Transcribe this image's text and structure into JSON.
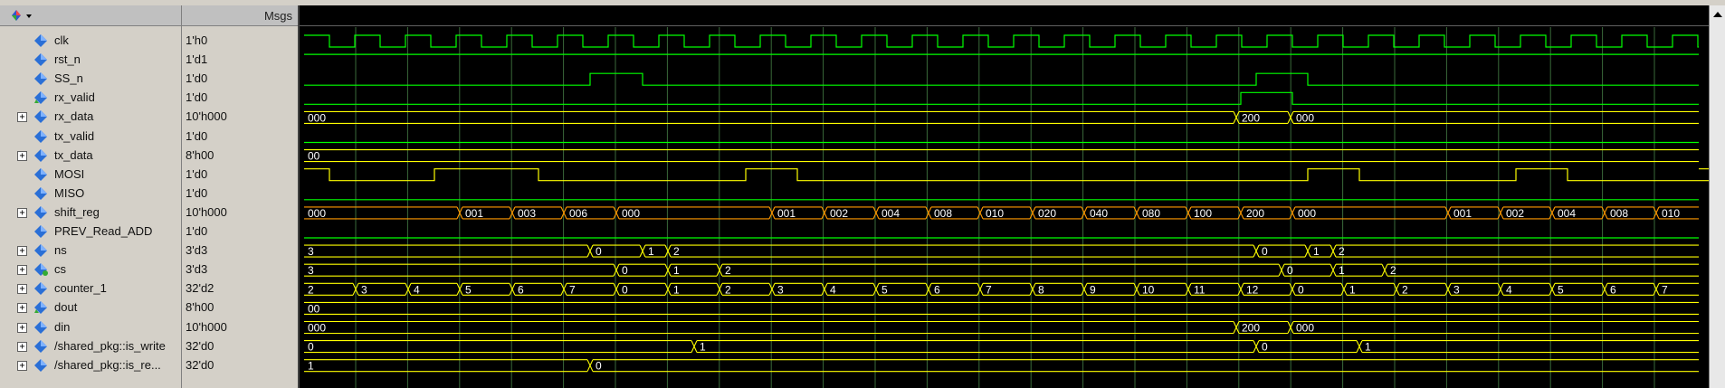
{
  "header": {
    "msgs_label": "Msgs"
  },
  "signals": [
    {
      "name": "clk",
      "value": "1'h0",
      "expandable": false,
      "icon": "signal-icon",
      "color": "#00ff00"
    },
    {
      "name": "rst_n",
      "value": "1'd1",
      "expandable": false,
      "icon": "signal-icon",
      "color": "#00ff00"
    },
    {
      "name": "SS_n",
      "value": "1'd0",
      "expandable": false,
      "icon": "signal-icon",
      "color": "#00ff00"
    },
    {
      "name": "rx_valid",
      "value": "1'd0",
      "expandable": false,
      "icon": "output-signal-icon",
      "color": "#00ff00"
    },
    {
      "name": "rx_data",
      "value": "10'h000",
      "expandable": true,
      "icon": "bus-signal-icon",
      "color": "#ffff00"
    },
    {
      "name": "tx_valid",
      "value": "1'd0",
      "expandable": false,
      "icon": "signal-icon",
      "color": "#00ff00"
    },
    {
      "name": "tx_data",
      "value": "8'h00",
      "expandable": true,
      "icon": "bus-signal-icon",
      "color": "#ffff00"
    },
    {
      "name": "MOSI",
      "value": "1'd0",
      "expandable": false,
      "icon": "signal-icon",
      "color": "#ffff00"
    },
    {
      "name": "MISO",
      "value": "1'd0",
      "expandable": false,
      "icon": "signal-icon",
      "color": "#00ff00"
    },
    {
      "name": "shift_reg",
      "value": "10'h000",
      "expandable": true,
      "icon": "bus-signal-icon",
      "color": "#ff9900"
    },
    {
      "name": "PREV_Read_ADD",
      "value": "1'd0",
      "expandable": false,
      "icon": "signal-icon",
      "color": "#00ff00"
    },
    {
      "name": "ns",
      "value": "3'd3",
      "expandable": true,
      "icon": "bus-signal-icon",
      "color": "#ffff00"
    },
    {
      "name": "cs",
      "value": "3'd3",
      "expandable": true,
      "icon": "state-signal-icon",
      "color": "#ffff00"
    },
    {
      "name": "counter_1",
      "value": "32'd2",
      "expandable": true,
      "icon": "bus-signal-icon",
      "color": "#ffff00"
    },
    {
      "name": "dout",
      "value": "8'h00",
      "expandable": true,
      "icon": "output-signal-icon",
      "color": "#ffff00"
    },
    {
      "name": "din",
      "value": "10'h000",
      "expandable": true,
      "icon": "bus-signal-icon",
      "color": "#ffff00"
    },
    {
      "name": "/shared_pkg::is_write",
      "value": "32'd0",
      "expandable": true,
      "icon": "bus-signal-icon",
      "color": "#ffff00"
    },
    {
      "name": "/shared_pkg::is_re...",
      "value": "32'd0",
      "expandable": true,
      "icon": "bus-signal-icon",
      "color": "#ffff00"
    }
  ],
  "waves": {
    "clk": {
      "type": "clock",
      "start": 0,
      "half_period": 28,
      "start_level": 1
    },
    "rst_n": {
      "type": "bit",
      "level0": 1,
      "edges": []
    },
    "SS_n": {
      "type": "bit",
      "level0": 0,
      "edges": [
        316,
        374,
        1052,
        1109
      ]
    },
    "rx_valid": {
      "type": "bit",
      "level0": 0,
      "edges": [
        1035,
        1092
      ],
      "mid_edge": true
    },
    "MOSI": {
      "type": "bit",
      "level0": 1,
      "edges": [
        28,
        144,
        259,
        488,
        545,
        1109,
        1166,
        1339,
        1396,
        1569
      ]
    },
    "tx_valid": {
      "type": "bit",
      "level0": 0,
      "edges": []
    },
    "MISO": {
      "type": "bit",
      "level0": 0,
      "edges": []
    },
    "PREV_Read_ADD": {
      "type": "bit",
      "level0": 0,
      "edges": []
    },
    "rx_data": {
      "type": "bus",
      "segments": [
        {
          "t": 0,
          "v": "000"
        },
        {
          "t": 1030,
          "v": "200"
        },
        {
          "t": 1090,
          "v": "000"
        }
      ]
    },
    "tx_data": {
      "type": "bus",
      "segments": [
        {
          "t": 0,
          "v": "00"
        }
      ]
    },
    "shift_reg": {
      "type": "bus",
      "segments": [
        {
          "t": 0,
          "v": "000"
        },
        {
          "t": 172,
          "v": "001"
        },
        {
          "t": 230,
          "v": "003"
        },
        {
          "t": 287,
          "v": "006"
        },
        {
          "t": 345,
          "v": "000"
        },
        {
          "t": 517,
          "v": "001"
        },
        {
          "t": 575,
          "v": "002"
        },
        {
          "t": 632,
          "v": "004"
        },
        {
          "t": 690,
          "v": "008"
        },
        {
          "t": 747,
          "v": "010"
        },
        {
          "t": 805,
          "v": "020"
        },
        {
          "t": 862,
          "v": "040"
        },
        {
          "t": 920,
          "v": "080"
        },
        {
          "t": 977,
          "v": "100"
        },
        {
          "t": 1035,
          "v": "200"
        },
        {
          "t": 1092,
          "v": "000"
        },
        {
          "t": 1264,
          "v": "001"
        },
        {
          "t": 1322,
          "v": "002"
        },
        {
          "t": 1379,
          "v": "004"
        },
        {
          "t": 1437,
          "v": "008"
        },
        {
          "t": 1494,
          "v": "010"
        }
      ]
    },
    "ns": {
      "type": "bus",
      "segments": [
        {
          "t": 0,
          "v": "3"
        },
        {
          "t": 316,
          "v": "0"
        },
        {
          "t": 374,
          "v": "1"
        },
        {
          "t": 402,
          "v": "2"
        },
        {
          "t": 1052,
          "v": "0"
        },
        {
          "t": 1109,
          "v": "1"
        },
        {
          "t": 1137,
          "v": "2"
        }
      ]
    },
    "cs": {
      "type": "bus",
      "segments": [
        {
          "t": 0,
          "v": "3"
        },
        {
          "t": 345,
          "v": "0"
        },
        {
          "t": 402,
          "v": "1"
        },
        {
          "t": 459,
          "v": "2"
        },
        {
          "t": 1080,
          "v": "0"
        },
        {
          "t": 1137,
          "v": "1"
        },
        {
          "t": 1194,
          "v": "2"
        }
      ]
    },
    "counter_1": {
      "type": "bus",
      "segments": [
        {
          "t": 0,
          "v": "2"
        },
        {
          "t": 57,
          "v": "3"
        },
        {
          "t": 115,
          "v": "4"
        },
        {
          "t": 172,
          "v": "5"
        },
        {
          "t": 230,
          "v": "6"
        },
        {
          "t": 287,
          "v": "7"
        },
        {
          "t": 345,
          "v": "0"
        },
        {
          "t": 402,
          "v": "1"
        },
        {
          "t": 459,
          "v": "2"
        },
        {
          "t": 517,
          "v": "3"
        },
        {
          "t": 575,
          "v": "4"
        },
        {
          "t": 632,
          "v": "5"
        },
        {
          "t": 690,
          "v": "6"
        },
        {
          "t": 747,
          "v": "7"
        },
        {
          "t": 805,
          "v": "8"
        },
        {
          "t": 862,
          "v": "9"
        },
        {
          "t": 920,
          "v": "10"
        },
        {
          "t": 977,
          "v": "11"
        },
        {
          "t": 1035,
          "v": "12"
        },
        {
          "t": 1092,
          "v": "0"
        },
        {
          "t": 1149,
          "v": "1"
        },
        {
          "t": 1207,
          "v": "2"
        },
        {
          "t": 1264,
          "v": "3"
        },
        {
          "t": 1322,
          "v": "4"
        },
        {
          "t": 1379,
          "v": "5"
        },
        {
          "t": 1437,
          "v": "6"
        },
        {
          "t": 1494,
          "v": "7"
        }
      ]
    },
    "dout": {
      "type": "bus",
      "segments": [
        {
          "t": 0,
          "v": "00"
        }
      ]
    },
    "din": {
      "type": "bus",
      "segments": [
        {
          "t": 0,
          "v": "000"
        },
        {
          "t": 1030,
          "v": "200"
        },
        {
          "t": 1090,
          "v": "000"
        }
      ]
    },
    "/shared_pkg::is_write": {
      "type": "bus",
      "segments": [
        {
          "t": 0,
          "v": "0"
        },
        {
          "t": 431,
          "v": "1"
        },
        {
          "t": 1052,
          "v": "0"
        },
        {
          "t": 1166,
          "v": "1"
        }
      ]
    },
    "/shared_pkg::is_re...": {
      "type": "bus",
      "segments": [
        {
          "t": 0,
          "v": "1"
        },
        {
          "t": 316,
          "v": "0"
        }
      ]
    }
  },
  "colors": {
    "grid": "#3a6a3a",
    "wave_green": "#00ff00",
    "wave_yellow": "#ffff00",
    "wave_orange": "#ff9900",
    "text_white": "#ffffff",
    "wave_bg": "#000000"
  }
}
